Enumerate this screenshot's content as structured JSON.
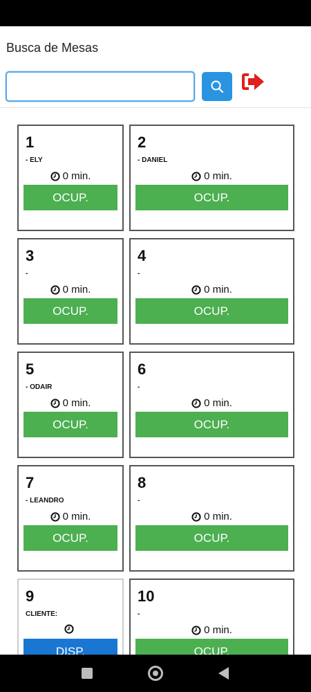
{
  "header": {
    "title": "Busca de Mesas"
  },
  "search": {
    "value": "",
    "placeholder": ""
  },
  "icons": {
    "search": "search-icon",
    "logout": "logout-icon",
    "clock": "clock-icon"
  },
  "colors": {
    "occupied": "#4caf50",
    "available": "#1976d2",
    "accent": "#2a94e0",
    "logout": "#e0201c"
  },
  "tables": [
    {
      "number": "1",
      "client": "- ELY",
      "timer": "0 min.",
      "status": "OCUP.",
      "state": "occupied"
    },
    {
      "number": "2",
      "client": "- DANIEL",
      "timer": "0 min.",
      "status": "OCUP.",
      "state": "occupied"
    },
    {
      "number": "3",
      "client": "-",
      "timer": "0 min.",
      "status": "OCUP.",
      "state": "occupied"
    },
    {
      "number": "4",
      "client": "-",
      "timer": "0 min.",
      "status": "OCUP.",
      "state": "occupied"
    },
    {
      "number": "5",
      "client": "- ODAIR",
      "timer": "0 min.",
      "status": "OCUP.",
      "state": "occupied"
    },
    {
      "number": "6",
      "client": "-",
      "timer": "0 min.",
      "status": "OCUP.",
      "state": "occupied"
    },
    {
      "number": "7",
      "client": "- LEANDRO",
      "timer": "0 min.",
      "status": "OCUP.",
      "state": "occupied"
    },
    {
      "number": "8",
      "client": "-",
      "timer": "0 min.",
      "status": "OCUP.",
      "state": "occupied"
    },
    {
      "number": "9",
      "client": "CLIENTE:",
      "timer": "",
      "status": "DISP.",
      "state": "available"
    },
    {
      "number": "10",
      "client": "-",
      "timer": "0 min.",
      "status": "OCUP.",
      "state": "occupied"
    }
  ]
}
